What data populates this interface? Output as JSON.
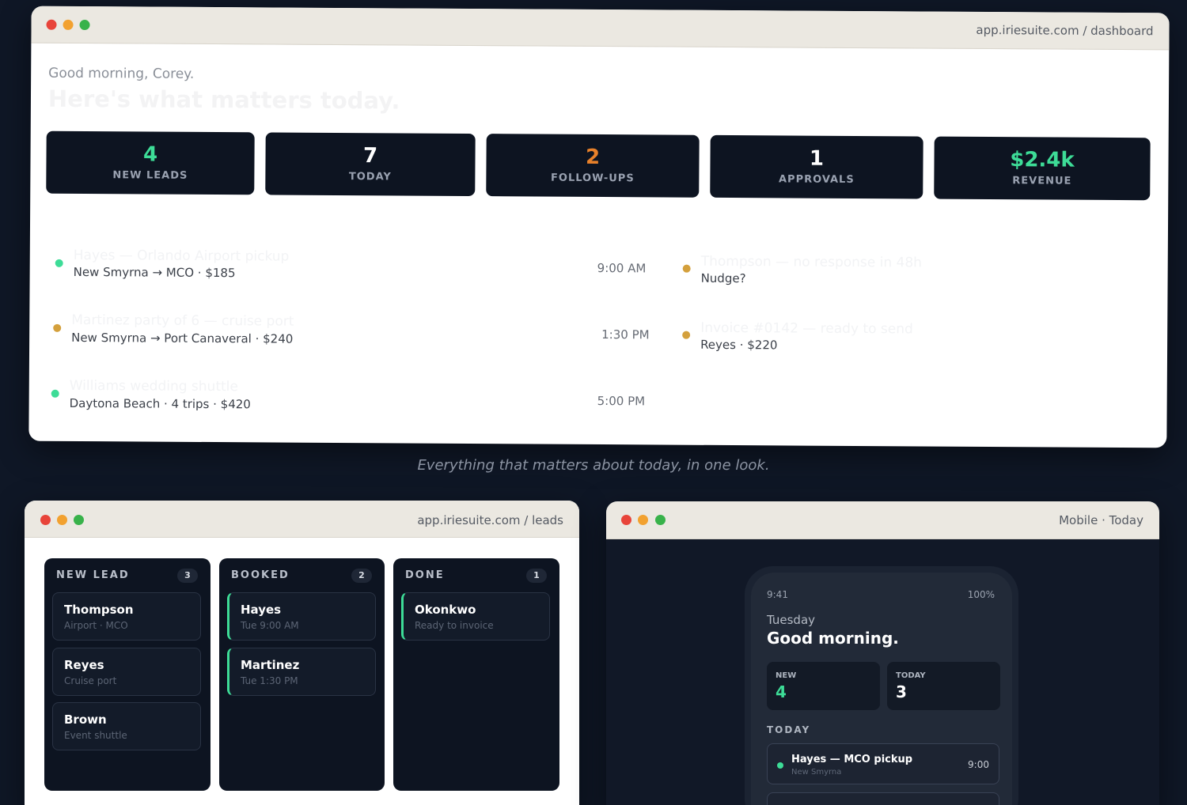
{
  "caption": "Everything that matters about today, in one look.",
  "dashboard": {
    "url": "app.iriesuite.com / dashboard",
    "greeting": "Good morning, Corey.",
    "headline": "Here's what matters today.",
    "kpis": [
      {
        "value": "4",
        "label": "NEW LEADS",
        "color": "#3ddc97"
      },
      {
        "value": "7",
        "label": "TODAY",
        "color": "#ffffff"
      },
      {
        "value": "2",
        "label": "FOLLOW-UPS",
        "color": "#e8812a"
      },
      {
        "value": "1",
        "label": "APPROVALS",
        "color": "#ffffff"
      },
      {
        "value": "$2.4k",
        "label": "REVENUE",
        "color": "#3ddc97"
      }
    ],
    "schedule": [
      {
        "title": "Hayes — Orlando Airport pickup",
        "sub": "New Smyrna → MCO · $185",
        "time": "9:00 AM",
        "dot": "#3ddc97"
      },
      {
        "title": "Martinez party of 6 — cruise port",
        "sub": "New Smyrna → Port Canaveral · $240",
        "time": "1:30 PM",
        "dot": "#d4a03c"
      },
      {
        "title": "Williams wedding shuttle",
        "sub": "Daytona Beach · 4 trips · $420",
        "time": "5:00 PM",
        "dot": "#3ddc97"
      }
    ],
    "actions": [
      {
        "title": "Thompson — no response in 48h",
        "sub": "Nudge?",
        "dot": "#d4a03c"
      },
      {
        "title": "Invoice #0142 — ready to send",
        "sub": "Reyes · $220",
        "dot": "#d4a03c"
      }
    ]
  },
  "leads": {
    "url": "app.iriesuite.com / leads",
    "columns": [
      {
        "title": "NEW LEAD",
        "count": "3",
        "cards": [
          {
            "name": "Thompson",
            "sub": "Airport · MCO"
          },
          {
            "name": "Reyes",
            "sub": "Cruise port"
          },
          {
            "name": "Brown",
            "sub": "Event shuttle"
          }
        ]
      },
      {
        "title": "BOOKED",
        "count": "2",
        "cards": [
          {
            "name": "Hayes",
            "sub": "Tue 9:00 AM"
          },
          {
            "name": "Martinez",
            "sub": "Tue 1:30 PM"
          }
        ]
      },
      {
        "title": "DONE",
        "count": "1",
        "cards": [
          {
            "name": "Okonkwo",
            "sub": "Ready to invoice"
          }
        ]
      }
    ]
  },
  "mobile": {
    "title": "Mobile · Today",
    "status_time": "9:41",
    "battery": "100%",
    "day": "Tuesday",
    "greeting": "Good morning.",
    "tiles": [
      {
        "label": "NEW",
        "value": "4",
        "color": "#3ddc97"
      },
      {
        "label": "TODAY",
        "value": "3",
        "color": "#ffffff"
      }
    ],
    "section": "TODAY",
    "items": [
      {
        "title": "Hayes — MCO pickup",
        "sub": "New Smyrna",
        "time": "9:00"
      }
    ]
  }
}
